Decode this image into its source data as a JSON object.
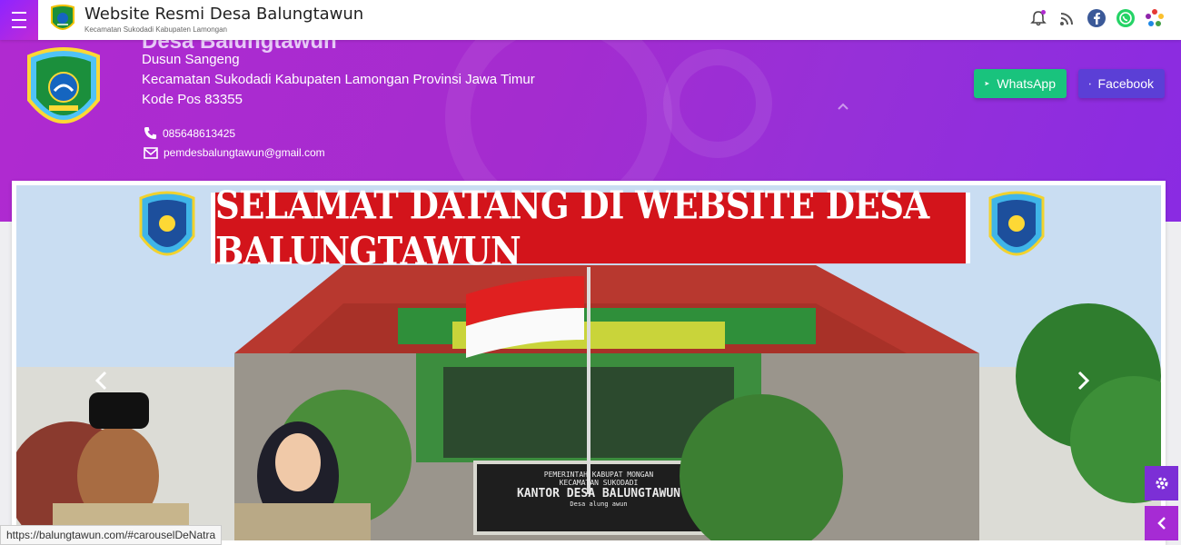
{
  "topbar": {
    "title": "Website Resmi Desa Balungtawun",
    "subtitle": "Kecamatan Sukodadi  Kabupaten Lamongan",
    "icons": [
      "bell-icon",
      "rss-icon",
      "facebook-icon",
      "whatsapp-icon",
      "settings-flower-icon"
    ]
  },
  "hero": {
    "village_name": "Desa Balungtawun",
    "dusun": "Dusun Sangeng",
    "address": "Kecamatan Sukodadi Kabupaten Lamongan Provinsi Jawa Timur",
    "postal": "Kode Pos 83355",
    "phone": "085648613425",
    "email": "pemdesbalungtawun@gmail.com",
    "whatsapp_label": "WhatsApp",
    "facebook_label": "Facebook"
  },
  "carousel": {
    "banner_text": "SELAMAT DATANG DI WEBSITE DESA BALUNGTAWUN",
    "sign_line1": "PEMERINTAH KABUPAT      MONGAN",
    "sign_line2": "KECAMATAN SUKODADI",
    "sign_line3": "KANTOR DESA BALUNGTAWUN",
    "sign_line4": "Desa  alung awun"
  },
  "status_bar": {
    "url": "https://balungtawun.com/#carouselDeNatra"
  },
  "colors": {
    "accent": "#9b2fd8",
    "whatsapp": "#19c37d",
    "facebook": "#5b3fd6",
    "banner_red": "#d3141b"
  }
}
